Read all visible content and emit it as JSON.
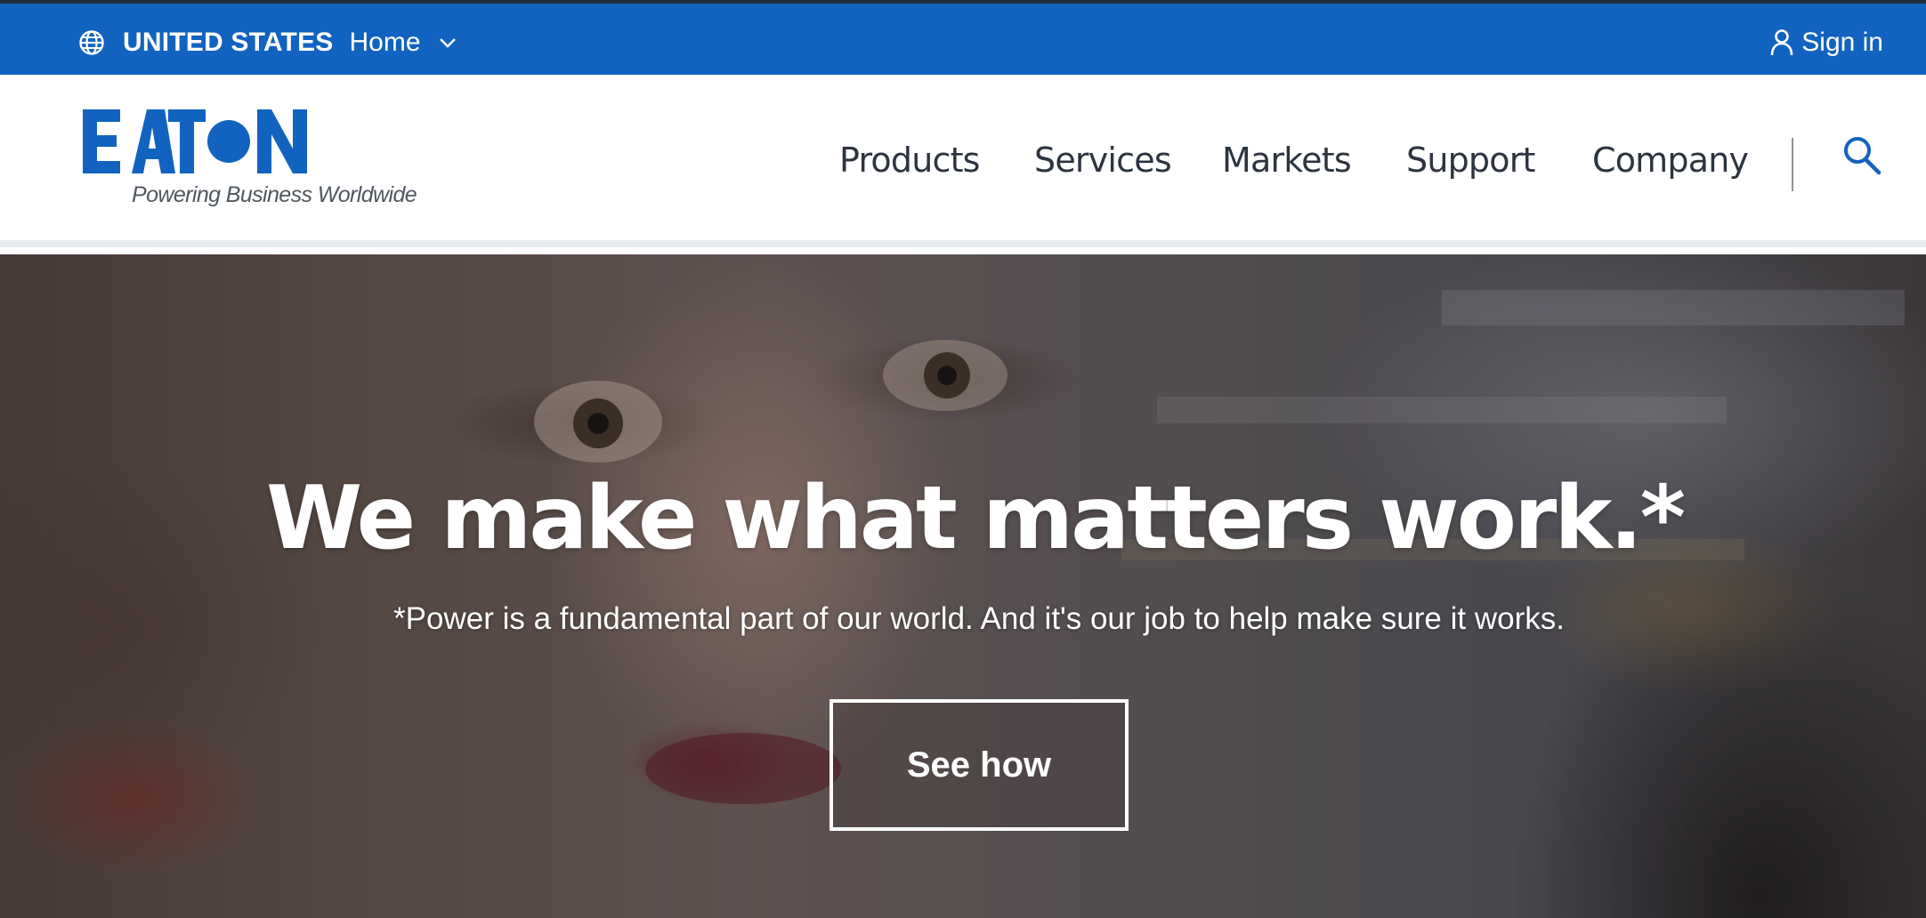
{
  "topbar": {
    "country": "UNITED STATES",
    "home_label": "Home",
    "signin_label": "Sign in",
    "icons": {
      "globe": "globe-icon",
      "chevron": "chevron-down-icon",
      "user": "user-icon"
    }
  },
  "header": {
    "logo_text": "EATON",
    "tagline": "Powering Business Worldwide",
    "nav": [
      "Products",
      "Services",
      "Markets",
      "Support",
      "Company"
    ],
    "search_icon": "search-icon"
  },
  "hero": {
    "title": "We make what matters work.*",
    "subtitle": "*Power is a fundamental part of our world. And it's our job to help make sure it works.",
    "cta_label": "See how"
  },
  "colors": {
    "brand_blue": "#1263bf",
    "nav_text": "#2c3440",
    "hero_text": "#ffffff"
  }
}
